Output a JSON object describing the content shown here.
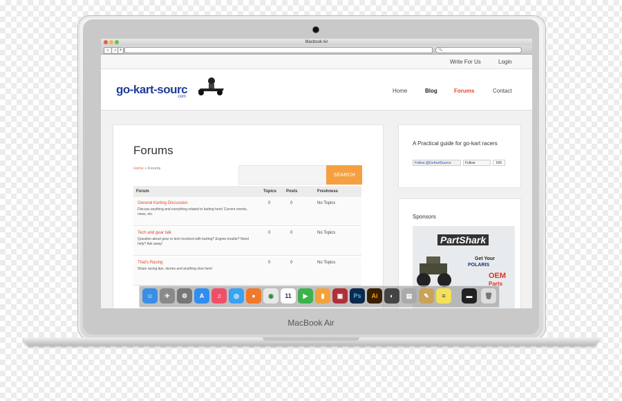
{
  "window": {
    "title": "Macbook Air"
  },
  "device": {
    "brand_label": "MacBook Air"
  },
  "top_links": {
    "write": "Write For Us",
    "login": "Login"
  },
  "logo": {
    "name": "go-kart-sourc",
    "sub": ".com"
  },
  "nav": {
    "home": "Home",
    "blog": "Blog",
    "forums": "Forums",
    "contact": "Contact",
    "active_color": "#e0482c"
  },
  "page": {
    "title": "Forums",
    "breadcrumb_home": "Home",
    "breadcrumb_sep": " » ",
    "breadcrumb_current": "Forums"
  },
  "search": {
    "button": "SEARCH"
  },
  "table": {
    "headers": {
      "forum": "Forum",
      "topics": "Topics",
      "posts": "Posts",
      "freshness": "Freshness"
    },
    "rows": [
      {
        "title": "General Karting Discussion",
        "desc": "Discuss anything and everything related to karting here! Current events, news, etc.",
        "topics": "0",
        "posts": "0",
        "freshness": "No Topics"
      },
      {
        "title": "Tech and gear talk",
        "desc": "Question about gear or tech involved with karting? Engine trouble? Need help? Ask away!",
        "topics": "0",
        "posts": "0",
        "freshness": "No Topics"
      },
      {
        "title": "That's Racing",
        "desc": "Share racing tips, stories and anything else here!",
        "topics": "0",
        "posts": "0",
        "freshness": "No Topics"
      }
    ]
  },
  "sidebar": {
    "about": "A Practical guide for go-kart racers",
    "twitter": "Follow @GoKartSource",
    "gplus": "Follow",
    "gplus_count": "606",
    "sponsors": "Sponsors"
  },
  "ad": {
    "logo": "PartShark",
    "get": "Get Your",
    "brand": "POLARIS",
    "oem": "OEM",
    "parts": "Parts"
  },
  "dock": [
    "finder-icon",
    "launchpad-icon",
    "system-preferences-icon",
    "app-store-icon",
    "itunes-icon",
    "safari-icon",
    "firefox-icon",
    "chrome-icon",
    "calendar-icon",
    "facetime-icon",
    "ibooks-icon",
    "photo-booth-icon",
    "photoshop-icon",
    "illustrator-icon",
    "iphoto-icon",
    "preview-icon",
    "scripts-icon",
    "notes-icon",
    "terminal-icon",
    "trash-icon"
  ]
}
